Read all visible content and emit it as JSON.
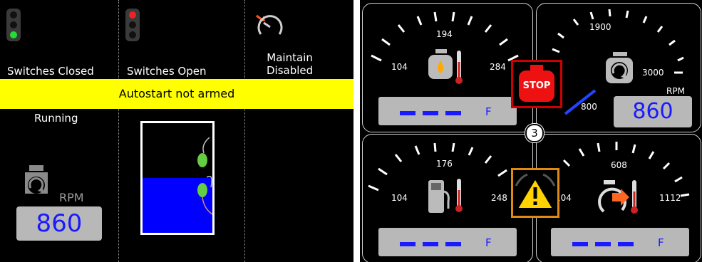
{
  "controller": {
    "status_closed": "Switches Closed",
    "status_open": "Switches Open",
    "maintain": "Maintain\nDisabled",
    "banner": "Autostart not armed",
    "running_label": "Running",
    "rpm_label": "RPM",
    "rpm_value": "860",
    "tank_level_fraction": 0.5,
    "colors": {
      "banner": "#ffff00",
      "rpm_value": "#1a1aff",
      "tank_fill": "#0000ff",
      "float": "#66cc44"
    }
  },
  "gauges": {
    "oil": {
      "icon": "oil-temp-icon",
      "min": "104",
      "mid": "194",
      "max": "284",
      "value": "———",
      "unit": "F"
    },
    "rpm": {
      "icon": "engine-rpm-icon",
      "low": "800",
      "mid": "1900",
      "max": "3000",
      "unit": "RPM",
      "value": "860"
    },
    "fuel": {
      "icon": "fuel-temp-icon",
      "min": "104",
      "mid": "176",
      "max": "248",
      "value": "———",
      "unit": "F"
    },
    "exhaust": {
      "icon": "exhaust-temp-icon",
      "min": "104",
      "mid": "608",
      "max": "1112",
      "value": "———",
      "unit": "F"
    },
    "center_badge": "3",
    "stop_label": "STOP",
    "warning_icon": "warning-icon"
  }
}
